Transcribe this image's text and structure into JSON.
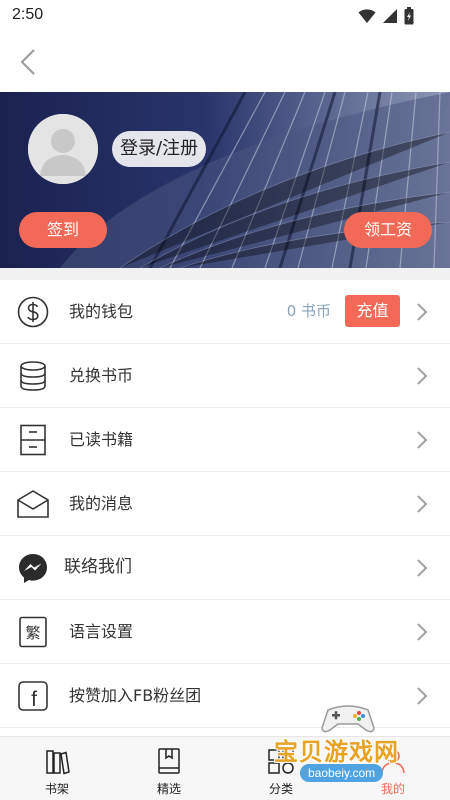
{
  "status_bar": {
    "time": "2:50",
    "icons": [
      "wifi-icon",
      "signal-icon",
      "battery-icon"
    ]
  },
  "header": {
    "back_icon": "back-chevron-icon"
  },
  "profile": {
    "login_label": "登录/注册",
    "signin_label": "签到",
    "salary_label": "领工资"
  },
  "menu": {
    "wallet": {
      "label": "我的钱包",
      "coins": "0 书币",
      "recharge": "充值",
      "icon": "dollar-coin-icon"
    },
    "exchange": {
      "label": "兑换书币",
      "icon": "coin-stack-icon"
    },
    "read_books": {
      "label": "已读书籍",
      "icon": "cabinet-icon"
    },
    "messages": {
      "label": "我的消息",
      "icon": "envelope-icon"
    },
    "contact": {
      "label": "联络我们",
      "icon": "messenger-icon"
    },
    "language": {
      "label": "语言设置",
      "icon": "traditional-char-icon",
      "glyph": "繁"
    },
    "facebook": {
      "label": "按赞加入FB粉丝团",
      "icon": "facebook-icon",
      "glyph": "f"
    }
  },
  "bottom_nav": {
    "items": [
      {
        "label": "书架",
        "icon": "bookshelf-icon"
      },
      {
        "label": "精选",
        "icon": "book-icon"
      },
      {
        "label": "分类",
        "icon": "category-grid-icon"
      },
      {
        "label": "我的",
        "icon": "profile-icon",
        "active": true
      }
    ]
  },
  "watermark": {
    "title": "宝贝游戏网",
    "url": "baobeiy.com"
  },
  "colors": {
    "accent": "#f26a57",
    "coin_text": "#8aa3b8",
    "banner_dark": "#1c2350"
  }
}
